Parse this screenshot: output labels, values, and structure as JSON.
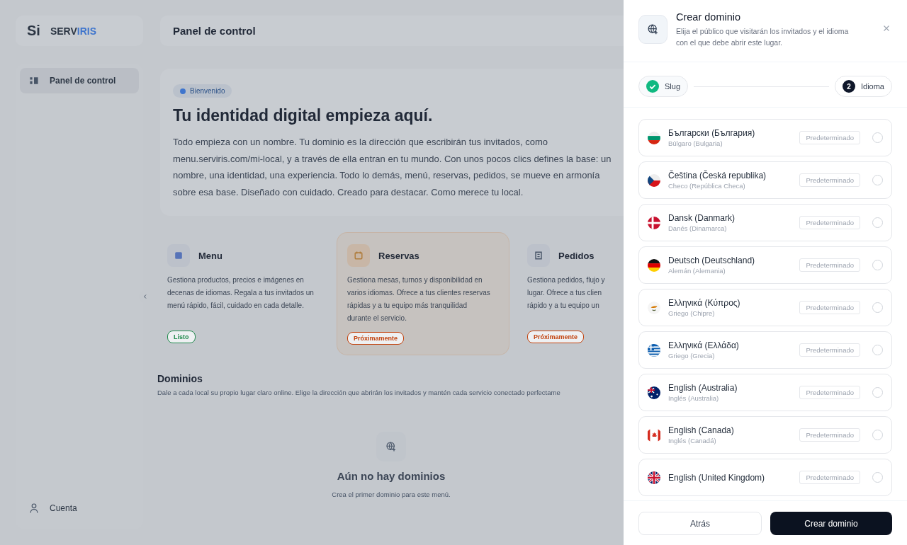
{
  "app": {
    "logo_mark": "Si",
    "logo_text_1": "SERV",
    "logo_text_2": "IRIS",
    "header_title": "Panel de control"
  },
  "sidebar": {
    "items": [
      {
        "label": "Panel de control",
        "selected": true
      }
    ],
    "footer_item": "Cuenta"
  },
  "hero": {
    "badge": "Bienvenido",
    "title": "Tu identidad digital empieza aquí.",
    "text": "Todo empieza con un nombre. Tu dominio es la dirección que escribirán tus invitados, como menu.serviris.com/mi-local, y a través de ella entran en tu mundo. Con unos pocos clics defines la base: un nombre, una identidad, una experiencia. Todo lo demás, menú, reservas, pedidos, se mueve en armonía sobre esa base. Diseñado con cuidado. Creado para destacar. Como merece tu local."
  },
  "features": [
    {
      "title": "Menu",
      "kind": "menu",
      "lines": [
        "Gestiona productos, precios e imágenes en",
        "decenas de idiomas. Regala a tus invitados un",
        "menú rápido, fácil, cuidado en cada detalle."
      ],
      "status": "Listo",
      "color": "#1f8a4c",
      "highlighted": false
    },
    {
      "title": "Reservas",
      "kind": "reservas",
      "lines": [
        "Gestiona mesas, turnos y disponibilidad en",
        "varios idiomas. Ofrece a tus clientes reservas",
        "rápidas y a tu equipo más tranquilidad",
        "durante el servicio."
      ],
      "status": "Próximamente",
      "color": "#c2410c",
      "highlighted": true
    },
    {
      "title": "Pedidos",
      "kind": "pedidos",
      "lines": [
        "Gestiona pedidos, flujo y",
        "lugar. Ofrece a tus clien",
        "rápido y a tu equipo un"
      ],
      "status": "Próximamente",
      "color": "#c2410c",
      "highlighted": false
    }
  ],
  "domains": {
    "title": "Dominios",
    "subtitle": "Dale a cada local su propio lugar claro online. Elige la dirección que abrirán los invitados y mantén cada servicio conectado perfectame",
    "empty_title": "Aún no hay dominios",
    "empty_text": "Crea el primer dominio para este menú."
  },
  "drawer": {
    "title": "Crear dominio",
    "subtitle": "Elija el público que visitarán los invitados y el idioma con el que debe abrir este lugar.",
    "steps": [
      {
        "label": "Slug",
        "done": true
      },
      {
        "label": "Idioma",
        "done": false,
        "number": "2"
      }
    ],
    "languages": [
      {
        "name": "Български (България)",
        "native": "Búlgaro (Bulgaria)",
        "kind": "bg",
        "tag": "Predeterminado",
        "selected": false
      },
      {
        "name": "Čeština (Česká republika)",
        "native": "Checo (República Checa)",
        "kind": "cz",
        "tag": "Predeterminado",
        "selected": false
      },
      {
        "name": "Dansk (Danmark)",
        "native": "Danés (Dinamarca)",
        "kind": "dk",
        "tag": "Predeterminado",
        "selected": false
      },
      {
        "name": "Deutsch (Deutschland)",
        "native": "Alemán (Alemania)",
        "kind": "de",
        "tag": "Predeterminado",
        "selected": false
      },
      {
        "name": "Ελληνικά (Κύπρος)",
        "native": "Griego (Chipre)",
        "kind": "cy",
        "tag": "Predeterminado",
        "selected": false
      },
      {
        "name": "Ελληνικά (Ελλάδα)",
        "native": "Griego (Grecia)",
        "kind": "gr",
        "tag": "Predeterminado",
        "selected": false
      },
      {
        "name": "English (Australia)",
        "native": "Inglés (Australia)",
        "kind": "au",
        "tag": "Predeterminado",
        "selected": false
      },
      {
        "name": "English (Canada)",
        "native": "Inglés (Canadá)",
        "kind": "ca",
        "tag": "Predeterminado",
        "selected": false
      },
      {
        "name": "English (United Kingdom)",
        "kind": "gb",
        "tag": "Predeterminado",
        "selected": false
      }
    ],
    "buttons": [
      {
        "label": "Atrás",
        "kind": "secondary"
      },
      {
        "label": "Crear dominio",
        "kind": "primary"
      }
    ]
  }
}
